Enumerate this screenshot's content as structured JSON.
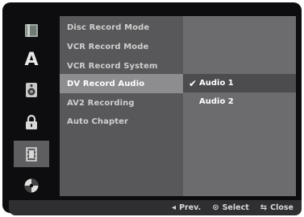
{
  "icons": [
    {
      "name": "disc-icon"
    },
    {
      "name": "language-icon",
      "glyph": "A"
    },
    {
      "name": "audio-speaker-icon"
    },
    {
      "name": "lock-icon"
    },
    {
      "name": "record-film-icon"
    },
    {
      "name": "others-disc-icon"
    }
  ],
  "menu": {
    "items": [
      {
        "label": "Disc Record Mode"
      },
      {
        "label": "VCR Record Mode"
      },
      {
        "label": "VCR Record System"
      },
      {
        "label": "DV Record Audio"
      },
      {
        "label": "AV2 Recording"
      },
      {
        "label": "Auto Chapter"
      }
    ],
    "selected_index": 3
  },
  "options": {
    "items": [
      {
        "label": "Audio 1",
        "checked": true
      },
      {
        "label": "Audio 2",
        "checked": false
      }
    ]
  },
  "bottom_bar": {
    "prev_glyph": "◂",
    "prev_label": "Prev.",
    "select_glyph": "⊙",
    "select_label": "Select",
    "close_glyph": "⇆",
    "close_label": "Close"
  },
  "colors": {
    "background": "#0d0d0f",
    "menu_panel": "#58585a",
    "menu_selected": "#8d8d90",
    "options_panel": "#6c6c6f",
    "bottom_bar": "#2f2f31"
  }
}
